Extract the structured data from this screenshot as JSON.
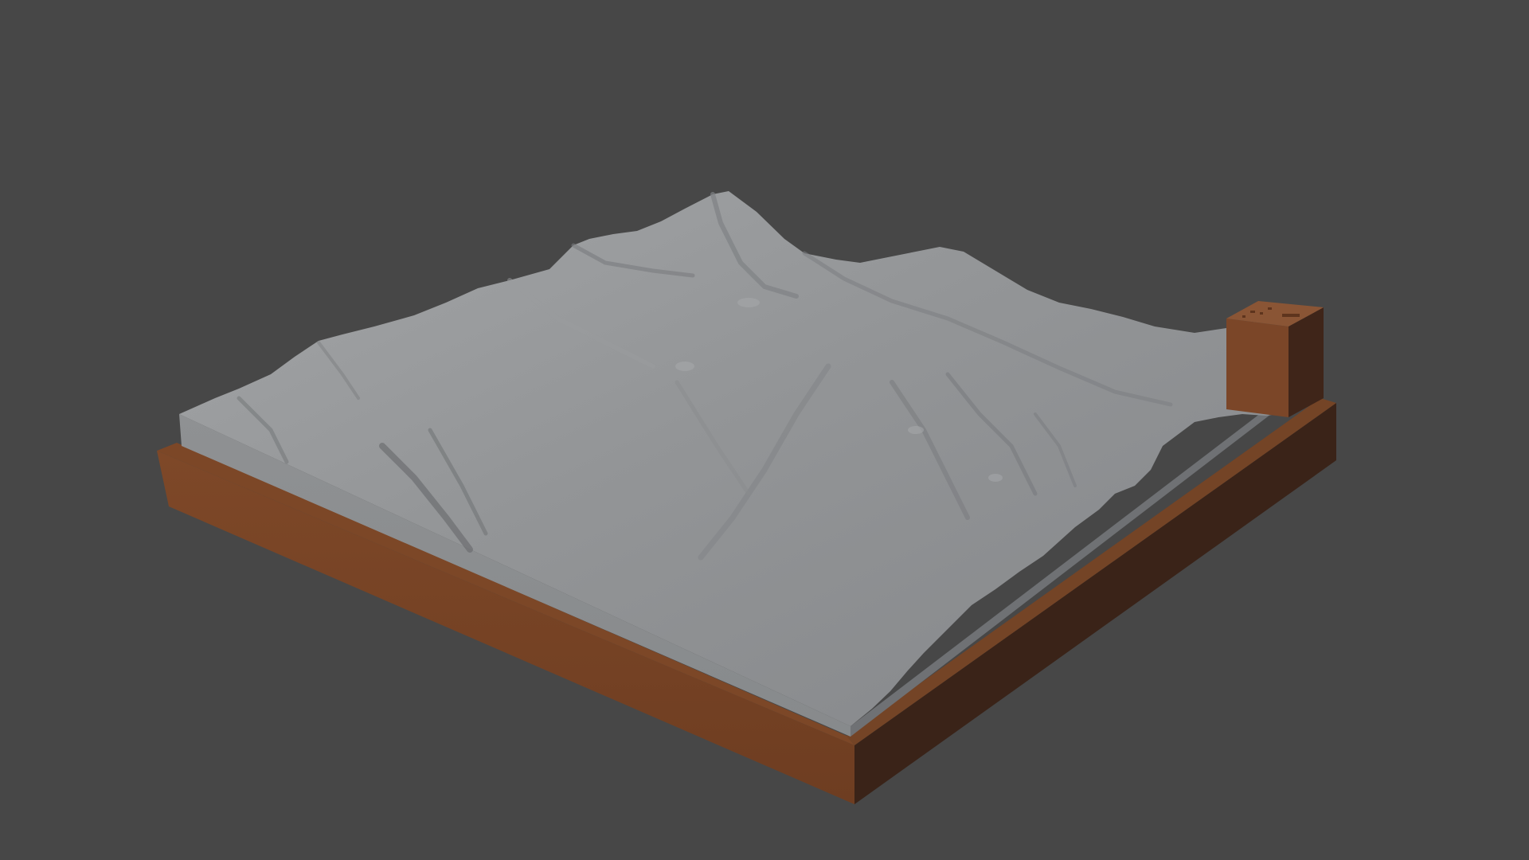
{
  "viewport": {
    "background_color": "#474747"
  },
  "model": {
    "terrain_color": "#8e9092",
    "terrain_side_color": "#8b8d8f",
    "base_color": "#7a4526",
    "base_dark_color": "#3c2419",
    "tab_color": "#7b4628",
    "tab_top_color": "#8a5535"
  }
}
